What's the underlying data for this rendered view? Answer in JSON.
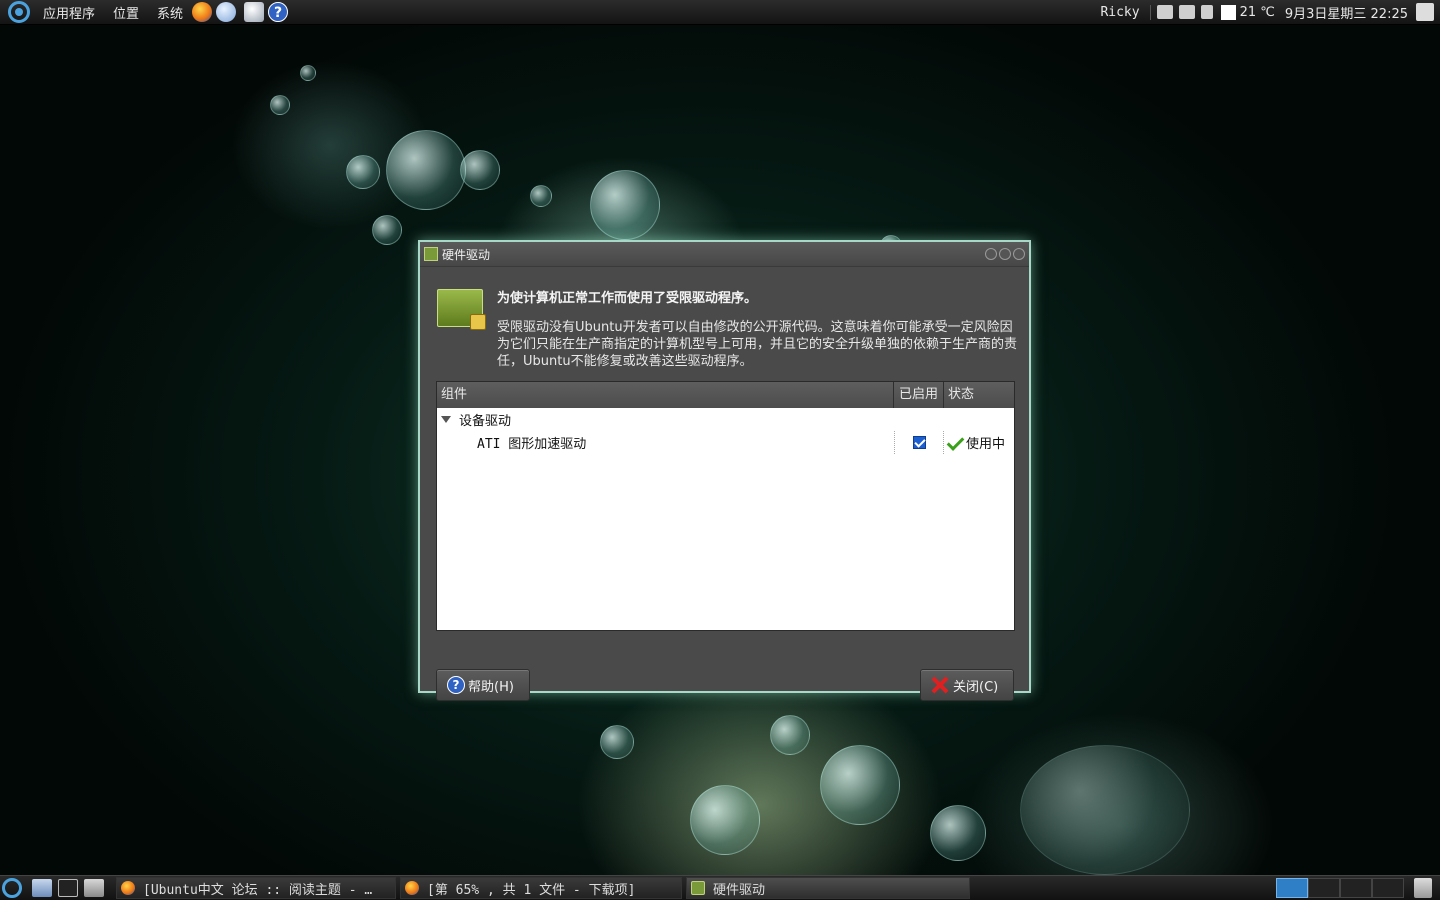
{
  "top_panel": {
    "menus": [
      "应用程序",
      "位置",
      "系统"
    ],
    "user": "Ricky",
    "temperature": "21 ℃",
    "clock": "9月3日星期三 22:25"
  },
  "dialog": {
    "title": "硬件驱动",
    "headline": "为使计算机正常工作而使用了受限驱动程序。",
    "description": "受限驱动没有Ubuntu开发者可以自由修改的公开源代码。这意味着你可能承受一定风险因为它们只能在生产商指定的计算机型号上可用，并且它的安全升级单独的依赖于生产商的责任，Ubuntu不能修复或改善这些驱动程序。",
    "columns": {
      "component": "组件",
      "enabled": "已启用",
      "status": "状态"
    },
    "category": "设备驱动",
    "driver": {
      "name": "ATI 图形加速驱动",
      "enabled": true,
      "status": "使用中"
    },
    "help_button": "帮助(H)",
    "close_button": "关闭(C)"
  },
  "bottom_panel": {
    "tasks": [
      "[Ubuntu中文 论坛 :: 阅读主题 - …",
      "[第 65% , 共 1 文件 - 下载项]",
      "硬件驱动"
    ]
  }
}
